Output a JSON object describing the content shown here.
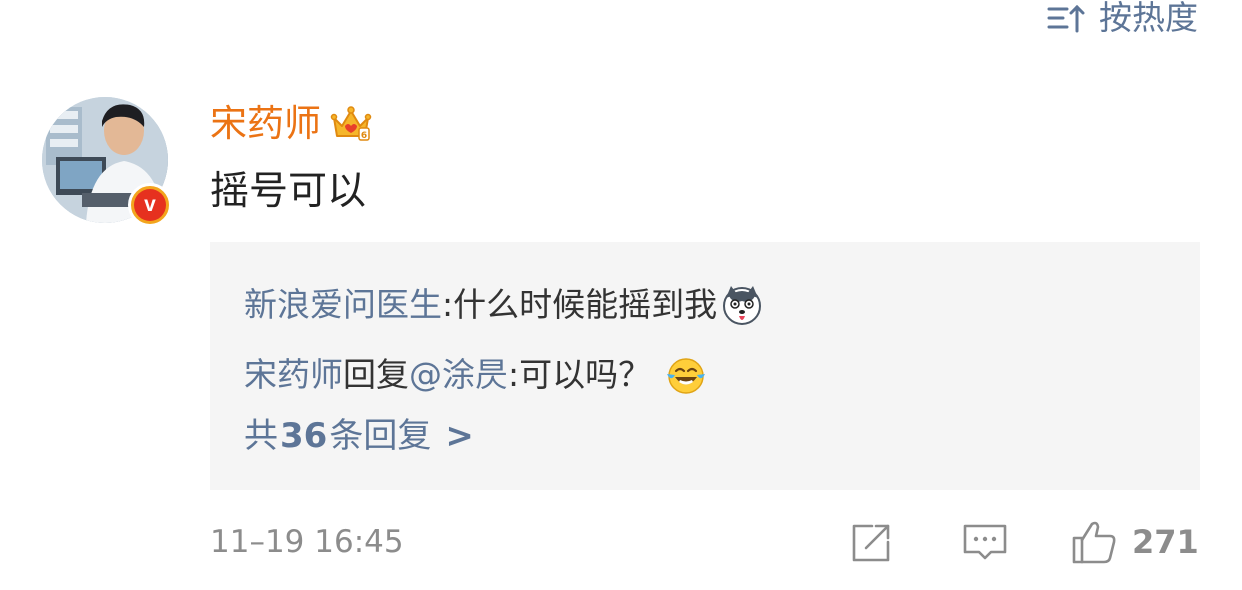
{
  "header": {
    "sort_label": "按热度",
    "sort_icon": "sort-descending-icon"
  },
  "comment": {
    "username": "宋药师",
    "badge_icon": "crown-vip-icon",
    "verified_icon": "verified-v-badge-icon",
    "text": "摇号可以",
    "timestamp": "11–19 16:45",
    "like_count": "271"
  },
  "replies": [
    {
      "author": "新浪爱问医生",
      "separator": ":",
      "text": " 什么时候能摇到我",
      "emoji": "husky-dog-emoji"
    },
    {
      "author": "宋药师",
      "action": "回复",
      "mention": "@涂昃",
      "text": ":可以吗？",
      "emoji": "laughing-tears-emoji"
    }
  ],
  "more_replies": {
    "prefix": "共",
    "count": "36",
    "suffix": "条回复",
    "arrow": ">"
  },
  "colors": {
    "link": "#5d7597",
    "username": "#eb7314",
    "muted": "#8c8c8c",
    "reply_bg": "#f5f5f5"
  }
}
